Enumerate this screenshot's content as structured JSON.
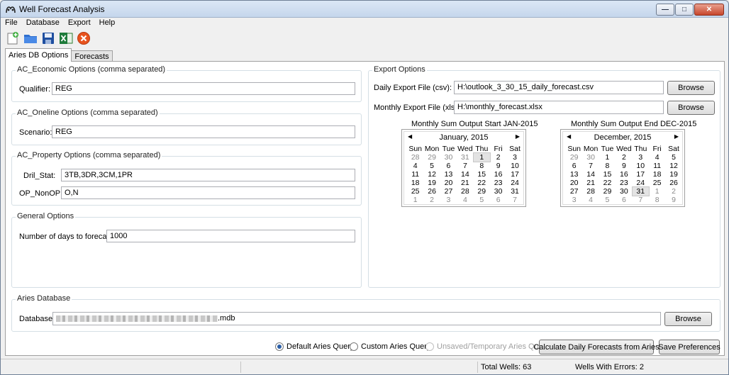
{
  "window": {
    "title": "Well Forecast Analysis"
  },
  "menu": [
    "File",
    "Database",
    "Export",
    "Help"
  ],
  "toolbar": [
    "new-file-icon",
    "open-folder-icon",
    "save-icon",
    "excel-icon",
    "cancel-icon"
  ],
  "tabs": [
    {
      "label": "Aries DB Options",
      "active": true
    },
    {
      "label": "Forecasts",
      "active": false
    }
  ],
  "economic": {
    "title": "AC_Economic Options (comma separated)",
    "qualifier_label": "Qualifier:",
    "qualifier_value": "REG"
  },
  "oneline": {
    "title": "AC_Oneline Options (comma separated)",
    "scenario_label": "Scenario:",
    "scenario_value": "REG"
  },
  "property": {
    "title": "AC_Property Options (comma separated)",
    "dril_label": "Dril_Stat:",
    "dril_value": "3TB,3DR,3CM,1PR",
    "op_label": "OP_NonOP:",
    "op_value": "O,N"
  },
  "general": {
    "title": "General Options",
    "days_label": "Number of days to forecast:",
    "days_value": "1000"
  },
  "export": {
    "title": "Export Options",
    "daily_label": "Daily Export File (csv):",
    "daily_value": "H:\\outlook_3_30_15_daily_forecast.csv",
    "monthly_label": "Monthly Export File (xlsx):",
    "monthly_value": "H:\\monthly_forecast.xlsx",
    "browse": "Browse",
    "start_caption": "Monthly Sum Output Start JAN-2015",
    "end_caption": "Monthly Sum Output End DEC-2015"
  },
  "calendars": {
    "daynames": [
      "Sun",
      "Mon",
      "Tue",
      "Wed",
      "Thu",
      "Fri",
      "Sat"
    ],
    "start": {
      "month": "January, 2015",
      "weeks": [
        [
          "28",
          "29",
          "30",
          "31",
          "1",
          "2",
          "3"
        ],
        [
          "4",
          "5",
          "6",
          "7",
          "8",
          "9",
          "10"
        ],
        [
          "11",
          "12",
          "13",
          "14",
          "15",
          "16",
          "17"
        ],
        [
          "18",
          "19",
          "20",
          "21",
          "22",
          "23",
          "24"
        ],
        [
          "25",
          "26",
          "27",
          "28",
          "29",
          "30",
          "31"
        ],
        [
          "1",
          "2",
          "3",
          "4",
          "5",
          "6",
          "7"
        ]
      ],
      "dim": [
        [
          0,
          0
        ],
        [
          0,
          1
        ],
        [
          0,
          2
        ],
        [
          0,
          3
        ],
        [
          5,
          0
        ],
        [
          5,
          1
        ],
        [
          5,
          2
        ],
        [
          5,
          3
        ],
        [
          5,
          4
        ],
        [
          5,
          5
        ],
        [
          5,
          6
        ]
      ],
      "selected": [
        0,
        4
      ]
    },
    "end": {
      "month": "December, 2015",
      "weeks": [
        [
          "29",
          "30",
          "1",
          "2",
          "3",
          "4",
          "5"
        ],
        [
          "6",
          "7",
          "8",
          "9",
          "10",
          "11",
          "12"
        ],
        [
          "13",
          "14",
          "15",
          "16",
          "17",
          "18",
          "19"
        ],
        [
          "20",
          "21",
          "22",
          "23",
          "24",
          "25",
          "26"
        ],
        [
          "27",
          "28",
          "29",
          "30",
          "31",
          "1",
          "2"
        ],
        [
          "3",
          "4",
          "5",
          "6",
          "7",
          "8",
          "9"
        ]
      ],
      "dim": [
        [
          0,
          0
        ],
        [
          0,
          1
        ],
        [
          4,
          5
        ],
        [
          4,
          6
        ],
        [
          5,
          0
        ],
        [
          5,
          1
        ],
        [
          5,
          2
        ],
        [
          5,
          3
        ],
        [
          5,
          4
        ],
        [
          5,
          5
        ],
        [
          5,
          6
        ]
      ],
      "selected": [
        4,
        4
      ]
    }
  },
  "database": {
    "title": "Aries Database",
    "label": "Database:",
    "value_suffix": ".mdb",
    "browse": "Browse"
  },
  "query": {
    "default": "Default Aries Query",
    "custom": "Custom Aries Query",
    "temp": "Unsaved/Temporary Aries Query",
    "selected": "default"
  },
  "actions": {
    "calculate": "Calculate Daily Forecasts from Aries",
    "save": "Save Preferences"
  },
  "status": {
    "total": "Total Wells: 63",
    "errors": "Wells With Errors: 2"
  }
}
